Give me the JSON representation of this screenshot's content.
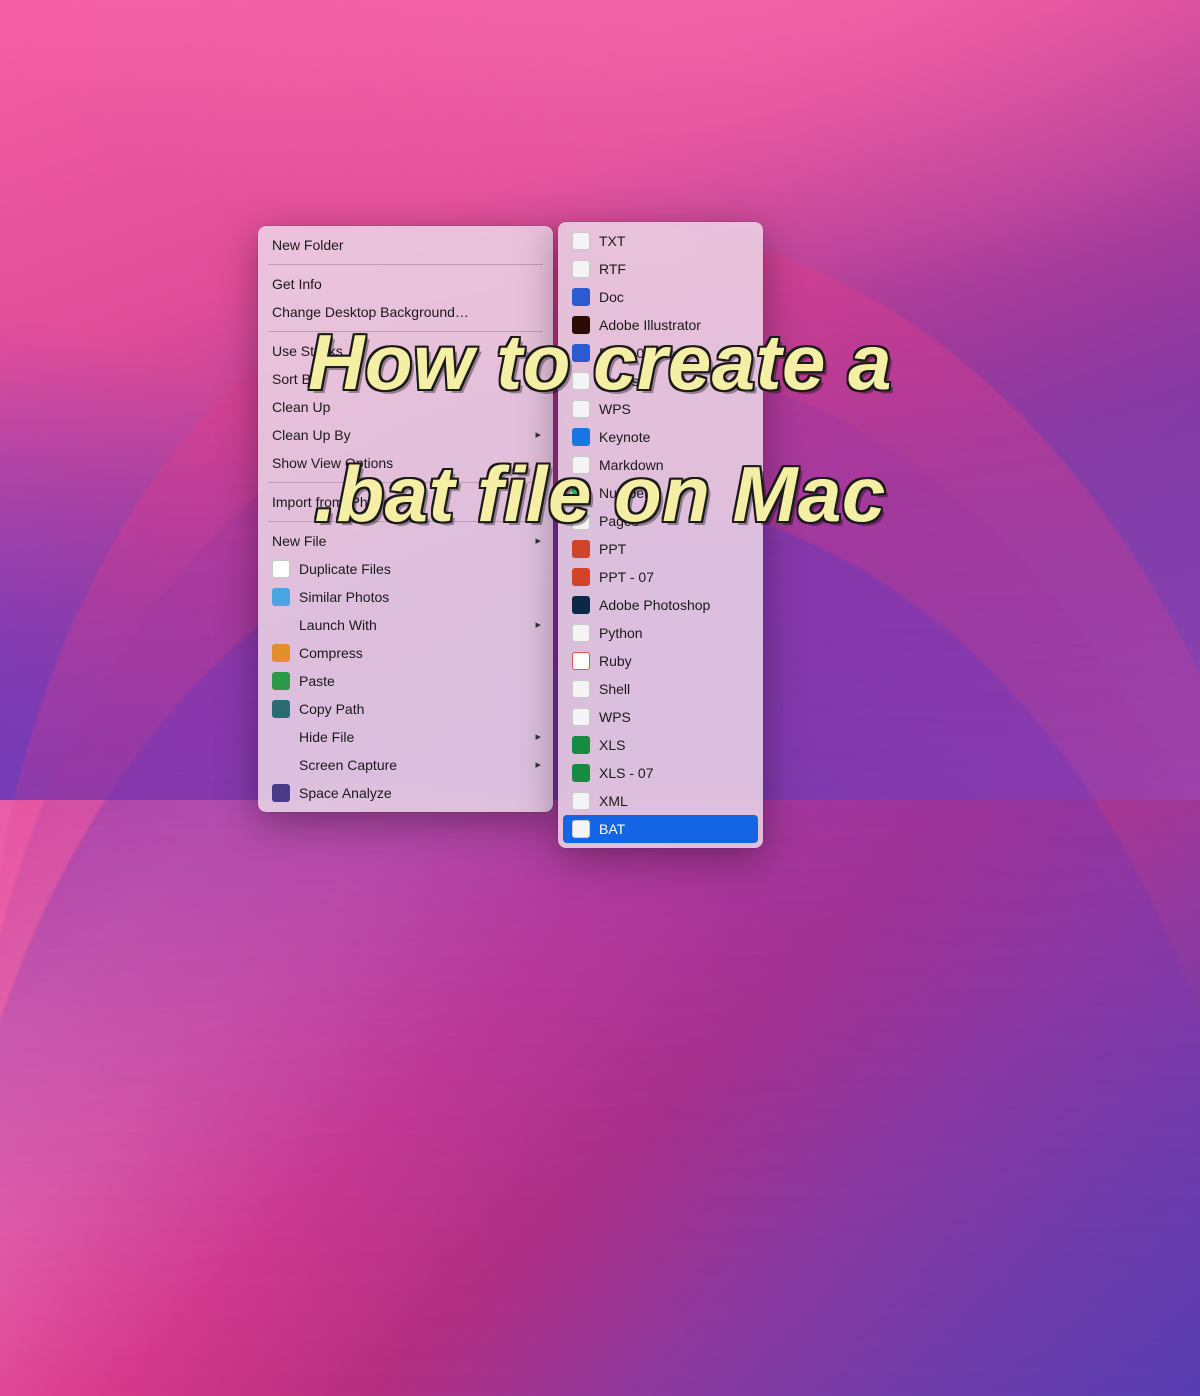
{
  "headline": {
    "line1": "How to create a",
    "line2": ".bat file on Mac"
  },
  "context_menu": {
    "groups": [
      [
        {
          "label": "New Folder",
          "arrow": false
        }
      ],
      [
        {
          "label": "Get Info",
          "arrow": false
        },
        {
          "label": "Change Desktop Background…",
          "arrow": false
        }
      ],
      [
        {
          "label": "Use Stacks",
          "arrow": false
        },
        {
          "label": "Sort By",
          "arrow": true
        },
        {
          "label": "Clean Up",
          "arrow": false
        },
        {
          "label": "Clean Up By",
          "arrow": true
        },
        {
          "label": "Show View Options",
          "arrow": false
        }
      ],
      [
        {
          "label": "Import from iPhone",
          "arrow": true
        }
      ],
      [
        {
          "label": "New File",
          "arrow": true
        },
        {
          "label": "Duplicate Files",
          "arrow": false,
          "icon": "dup"
        },
        {
          "label": "Similar Photos",
          "arrow": false,
          "icon": "photo"
        },
        {
          "label": "Launch With",
          "arrow": true
        },
        {
          "label": "Compress",
          "arrow": false,
          "icon": "comp"
        },
        {
          "label": "Paste",
          "arrow": false,
          "icon": "paste"
        },
        {
          "label": "Copy Path",
          "arrow": false,
          "icon": "copy"
        },
        {
          "label": "Hide File",
          "arrow": true
        },
        {
          "label": "Screen Capture",
          "arrow": true
        },
        {
          "label": "Space Analyze",
          "arrow": false,
          "icon": "space"
        }
      ]
    ]
  },
  "submenu": {
    "items": [
      {
        "label": "TXT",
        "icon": "txt"
      },
      {
        "label": "RTF",
        "icon": "rtf"
      },
      {
        "label": "Doc",
        "icon": "doc"
      },
      {
        "label": "Adobe Illustrator",
        "icon": "ai"
      },
      {
        "label": "Doc - 07",
        "icon": "doc07"
      },
      {
        "label": "Pages",
        "icon": "txt"
      },
      {
        "label": "WPS",
        "icon": "wps"
      },
      {
        "label": "Keynote",
        "icon": "key"
      },
      {
        "label": "Markdown",
        "icon": "md"
      },
      {
        "label": "Numbers",
        "icon": "num"
      },
      {
        "label": "Pages",
        "icon": "txt"
      },
      {
        "label": "PPT",
        "icon": "ppt"
      },
      {
        "label": "PPT - 07",
        "icon": "ppt07"
      },
      {
        "label": "Adobe Photoshop",
        "icon": "ps"
      },
      {
        "label": "Python",
        "icon": "py"
      },
      {
        "label": "Ruby",
        "icon": "rb"
      },
      {
        "label": "Shell",
        "icon": "shell"
      },
      {
        "label": "WPS",
        "icon": "wps"
      },
      {
        "label": "XLS",
        "icon": "xls"
      },
      {
        "label": "XLS - 07",
        "icon": "xls07"
      },
      {
        "label": "XML",
        "icon": "xml"
      },
      {
        "label": "BAT",
        "icon": "bat",
        "selected": true
      }
    ]
  }
}
